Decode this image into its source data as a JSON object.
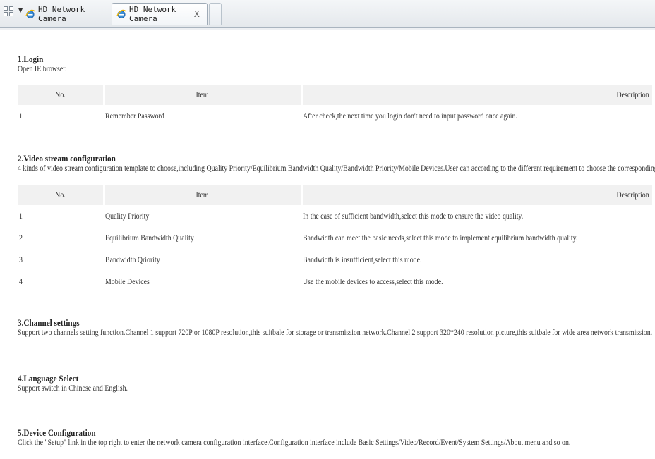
{
  "browser": {
    "tabs": [
      {
        "label": "HD Network Camera",
        "active": false
      },
      {
        "label": "HD Network Camera",
        "active": true,
        "close": "X"
      }
    ],
    "dropdown_glyph": "▼"
  },
  "sections": [
    {
      "title": "1.Login",
      "description": "Open IE browser.",
      "table": {
        "headers": [
          "No.",
          "Item",
          "Description"
        ],
        "rows": [
          [
            "1",
            "Remember Password",
            "After check,the next time you login don't need to input password once again."
          ]
        ]
      }
    },
    {
      "title": "2.Video stream configuration",
      "description": "4 kinds of video stream configuration template to choose,including Quality Priority/Equilibrium Bandwidth Quality/Bandwidth Priority/Mobile Devices.User can according to the different requirement to choose the corresponding template.",
      "table": {
        "headers": [
          "No.",
          "Item",
          "Description"
        ],
        "rows": [
          [
            "1",
            "Quality Priority",
            "In the case of sufficient bandwidth,select this mode to ensure the video quality."
          ],
          [
            "2",
            "Equilibrium Bandwidth Quality",
            "Bandwidth can meet the basic needs,select this mode to implement equilibrium bandwidth quality."
          ],
          [
            "3",
            "Bandwidth Qriority",
            "Bandwidth is insufficient,select this mode."
          ],
          [
            "4",
            "Mobile Devices",
            "Use the mobile devices to access,select this mode."
          ]
        ]
      }
    },
    {
      "title": "3.Channel settings",
      "description": "Support two channels setting function.Channel 1 support 720P or 1080P resolution,this suitbale for storage or transmission network.Channel 2 support 320*240 resolution picture,this suitbale for wide area network transmission."
    },
    {
      "title": "4.Language Select",
      "description": "Support switch in Chinese and English."
    },
    {
      "title": "5.Device Configuration",
      "description": "Click the \"Setup\" link in the top right to enter the network camera configuration interface.Configuration interface include Basic Settings/Video/Record/Event/System Settings/About menu and so on."
    }
  ]
}
